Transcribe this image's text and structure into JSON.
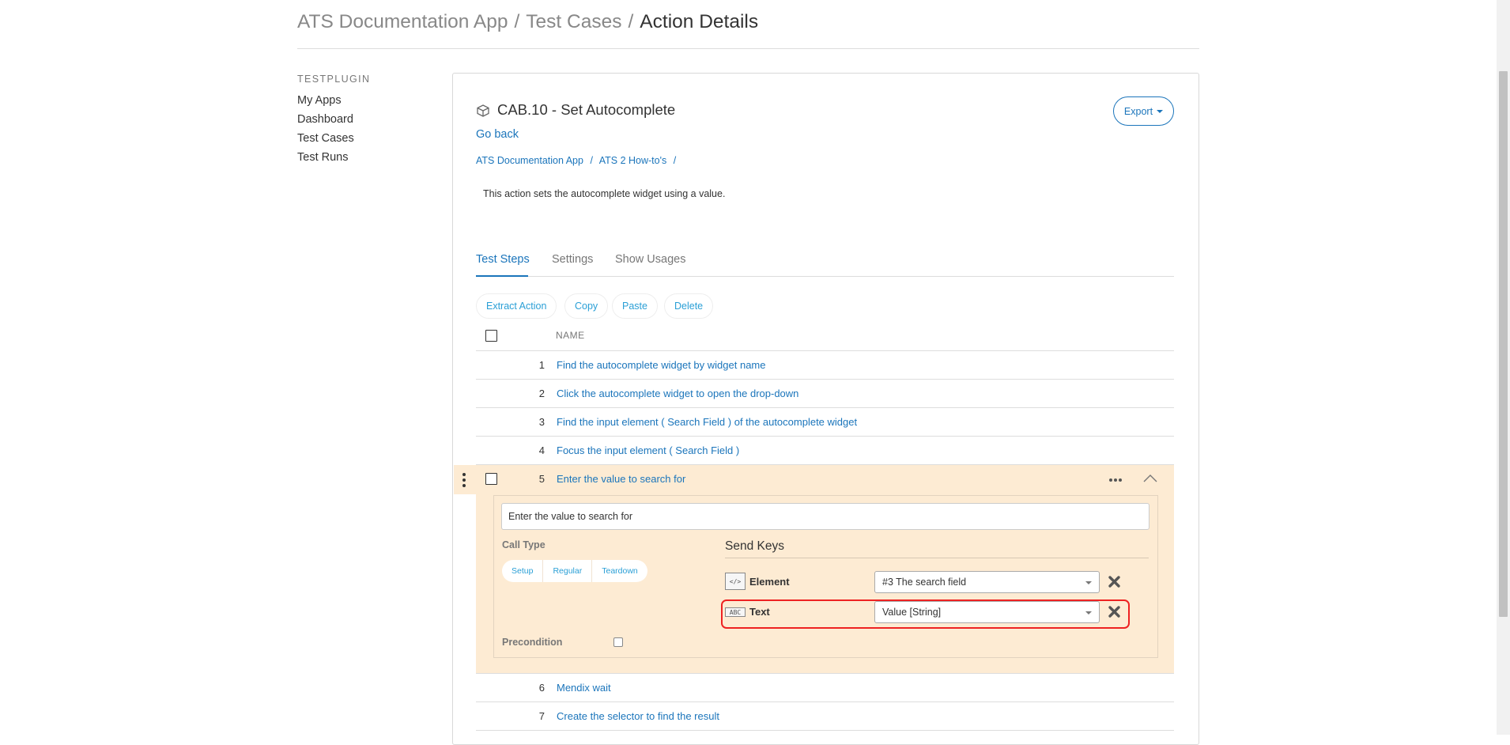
{
  "header": {
    "crumbs": [
      "ATS Documentation App",
      "Test Cases"
    ],
    "separator": "/",
    "current": "Action Details"
  },
  "sidebar": {
    "title": "TESTPLUGIN",
    "items": [
      "My Apps",
      "Dashboard",
      "Test Cases",
      "Test Runs"
    ]
  },
  "action": {
    "icon": "cube-icon",
    "title": "CAB.10 - Set Autocomplete",
    "export_label": "Export",
    "go_back": "Go back",
    "breadcrumb": [
      "ATS Documentation App",
      "/",
      "ATS 2 How-to's",
      "/"
    ],
    "description": "This action sets the autocomplete widget using a value."
  },
  "tabs": [
    "Test Steps",
    "Settings",
    "Show Usages"
  ],
  "toolbar": [
    "Extract Action",
    "Copy",
    "Paste",
    "Delete"
  ],
  "table": {
    "column_header": "NAME",
    "rows": [
      {
        "num": "1",
        "name": "Find the autocomplete widget by widget name"
      },
      {
        "num": "2",
        "name": "Click the autocomplete widget to open the drop-down"
      },
      {
        "num": "3",
        "name": "Find the input element ( Search Field ) of the autocomplete widget"
      },
      {
        "num": "4",
        "name": "Focus the input element ( Search Field )"
      },
      {
        "num": "5",
        "name": "Enter the value to search for"
      },
      {
        "num": "6",
        "name": "Mendix wait"
      },
      {
        "num": "7",
        "name": "Create the selector to find the result"
      }
    ]
  },
  "expanded": {
    "step_name_value": "Enter the value to search for",
    "call_type_label": "Call Type",
    "call_types": [
      "Setup",
      "Regular",
      "Teardown"
    ],
    "precondition_label": "Precondition",
    "send_keys_title": "Send Keys",
    "params": [
      {
        "icon_text": "</>",
        "label": "Element",
        "value": "#3 The search field"
      },
      {
        "icon_text": "ABC",
        "label": "Text",
        "value": "Value [String]"
      }
    ]
  },
  "colors": {
    "link": "#1b75bb",
    "expanded_bg": "#fdebd3",
    "highlight": "#ee2222"
  }
}
